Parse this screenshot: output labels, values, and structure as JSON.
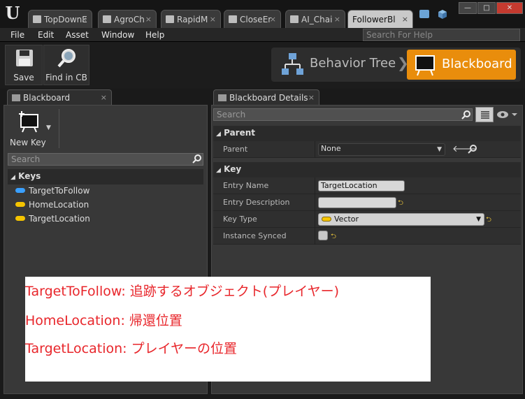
{
  "window": {
    "tabs": [
      {
        "label": "TopDownE"
      },
      {
        "label": "AgroCh"
      },
      {
        "label": "RapidM"
      },
      {
        "label": "CloseEr"
      },
      {
        "label": "AI_Chai"
      },
      {
        "label": "FollowerBl"
      }
    ],
    "tab_close": "×",
    "minimize": "—",
    "maximize": "□",
    "close": "✕"
  },
  "menu": {
    "items": [
      "File",
      "Edit",
      "Asset",
      "Window",
      "Help"
    ],
    "help_search_placeholder": "Search For Help"
  },
  "toolbar": {
    "save_label": "Save",
    "find_label": "Find in CB"
  },
  "breadcrumb": {
    "behavior_tree": "Behavior Tree",
    "chevron": "❯",
    "blackboard": "Blackboard"
  },
  "left_panel": {
    "tab_label": "Blackboard",
    "new_key_label": "New Key",
    "search_placeholder": "Search",
    "keys_header": "Keys",
    "keys": [
      {
        "name": "TargetToFollow",
        "color": "#3aa0ff"
      },
      {
        "name": "HomeLocation",
        "color": "#f5c400"
      },
      {
        "name": "TargetLocation",
        "color": "#f5c400"
      }
    ]
  },
  "right_panel": {
    "tab_label": "Blackboard Details",
    "search_placeholder": "Search",
    "parent_section": "Parent",
    "parent_label": "Parent",
    "parent_value": "None",
    "key_section": "Key",
    "entry_name_label": "Entry Name",
    "entry_name_value": "TargetLocation",
    "entry_desc_label": "Entry Description",
    "entry_desc_value": "",
    "key_type_label": "Key Type",
    "key_type_value": "Vector",
    "instance_synced_label": "Instance Synced"
  },
  "annotation": {
    "lines": [
      "TargetToFollow: 追跡するオブジェクト(プレイヤー)",
      "HomeLocation: 帰還位置",
      "TargetLocation: プレイヤーの位置"
    ]
  },
  "colors": {
    "accent": "#e98d0c",
    "annotation_text": "#e8262b",
    "object_key": "#3aa0ff",
    "vector_key": "#f5c400"
  }
}
